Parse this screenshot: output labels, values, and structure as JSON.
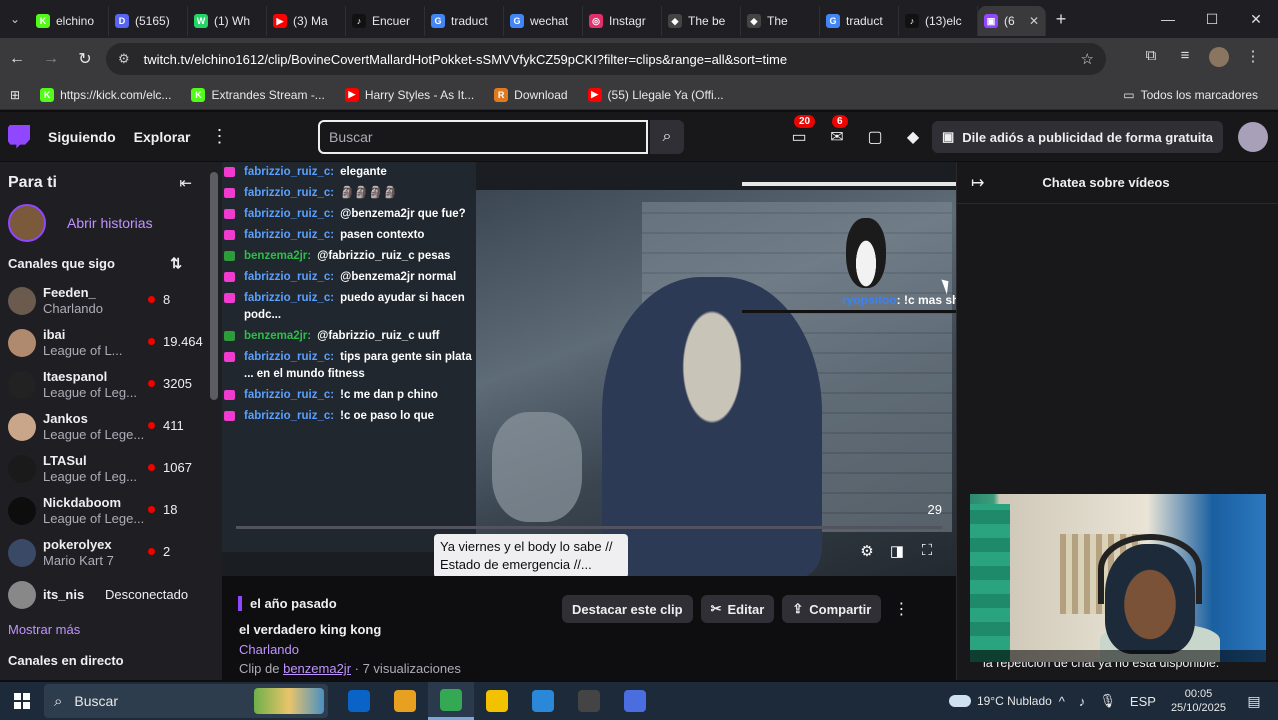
{
  "browser": {
    "tabs": [
      {
        "title": "elchino",
        "icon_color": "#53fc18",
        "icon_text": "K"
      },
      {
        "title": "(5165)",
        "icon_color": "#5865f2",
        "icon_text": "D"
      },
      {
        "title": "(1) Wh",
        "icon_color": "#25d366",
        "icon_text": "W"
      },
      {
        "title": "(3) Ma",
        "icon_color": "#ff0000",
        "icon_text": "▶"
      },
      {
        "title": "Encuer",
        "icon_color": "#111111",
        "icon_text": "♪"
      },
      {
        "title": "traduct",
        "icon_color": "#4285f4",
        "icon_text": "G"
      },
      {
        "title": "wechat",
        "icon_color": "#4285f4",
        "icon_text": "G"
      },
      {
        "title": "Instagr",
        "icon_color": "#e1306c",
        "icon_text": "◎"
      },
      {
        "title": "The be",
        "icon_color": "#444444",
        "icon_text": "◆"
      },
      {
        "title": "The",
        "icon_color": "#444444",
        "icon_text": "◆"
      },
      {
        "title": "traduct",
        "icon_color": "#4285f4",
        "icon_text": "G"
      },
      {
        "title": "(13)elc",
        "icon_color": "#111111",
        "icon_text": "♪"
      }
    ],
    "active_tab": {
      "title": "(6",
      "icon_color": "#9147ff",
      "icon_text": "▣"
    },
    "url": "twitch.tv/elchino1612/clip/BovineCovertMallardHotPokket-sSMVVfykCZ59pCKI?filter=clips&range=all&sort=time",
    "bookmarks": [
      {
        "label": "https://kick.com/elc...",
        "icon_color": "#53fc18",
        "icon_text": "K"
      },
      {
        "label": "Extrandes Stream -...",
        "icon_color": "#53fc18",
        "icon_text": "K"
      },
      {
        "label": "Harry Styles - As It...",
        "icon_color": "#ff0000",
        "icon_text": "▶"
      },
      {
        "label": "Download",
        "icon_color": "#e07a1f",
        "icon_text": "R"
      },
      {
        "label": "(55) Llegale Ya (Offi...",
        "icon_color": "#ff0000",
        "icon_text": "▶"
      }
    ],
    "all_bookmarks": "Todos los marcadores"
  },
  "twitch_nav": {
    "following": "Siguiendo",
    "browse": "Explorar",
    "search_placeholder": "Buscar",
    "notifications_count": "20",
    "inbox_count": "6",
    "ads_label": "Dile adiós a publicidad de forma gratuita"
  },
  "sidebar": {
    "for_you": "Para ti",
    "open_stories": "Abrir historias",
    "followed_header": "Canales que sigo",
    "channels": [
      {
        "name": "Feeden_",
        "game": "Charlando",
        "viewers": "8",
        "avatar_color": "#6b5a4e"
      },
      {
        "name": "ibai",
        "game": "League of L...",
        "viewers": "19.464",
        "avatar_color": "#b08a6e"
      },
      {
        "name": "Itaespanol",
        "game": "League of Leg...",
        "viewers": "3205",
        "avatar_color": "#222222"
      },
      {
        "name": "Jankos",
        "game": "League of Lege...",
        "viewers": "411",
        "avatar_color": "#c9a58a"
      },
      {
        "name": "LTASul",
        "game": "League of Leg...",
        "viewers": "1067",
        "avatar_color": "#1a1a1a"
      },
      {
        "name": "Nickdaboom",
        "game": "League of Lege...",
        "viewers": "18",
        "avatar_color": "#0d0d0d"
      },
      {
        "name": "pokerolyex",
        "game": "Mario Kart 7",
        "viewers": "2",
        "avatar_color": "#3a4a66"
      }
    ],
    "offline_channel": {
      "name": "its_nis",
      "status": "Desconectado",
      "avatar_color": "#888888"
    },
    "show_more": "Mostrar más",
    "live_header": "Canales en directo"
  },
  "video": {
    "chat_overlay": [
      {
        "user": "fabrizzio_ruiz_c:",
        "text": "elegante",
        "icon": "pink"
      },
      {
        "user": "fabrizzio_ruiz_c:",
        "text": "🗿🗿🗿🗿",
        "icon": "pink"
      },
      {
        "user": "fabrizzio_ruiz_c:",
        "text": "@benzema2jr que fue?",
        "icon": "pink"
      },
      {
        "user": "fabrizzio_ruiz_c:",
        "text": "pasen contexto",
        "icon": "pink"
      },
      {
        "user": "benzema2jr:",
        "text": "@fabrizzio_ruiz_c pesas",
        "icon": "green"
      },
      {
        "user": "fabrizzio_ruiz_c:",
        "text": "@benzema2jr normal",
        "icon": "pink"
      },
      {
        "user": "fabrizzio_ruiz_c:",
        "text": "puedo ayudar si hacen podc...",
        "icon": "pink"
      },
      {
        "user": "benzema2jr:",
        "text": "@fabrizzio_ruiz_c uuff",
        "icon": "green"
      },
      {
        "user": "fabrizzio_ruiz_c:",
        "text": "tips para gente sin plata ... en el mundo fitness",
        "icon": "pink"
      },
      {
        "user": "fabrizzio_ruiz_c:",
        "text": "!c me dan p chino",
        "icon": "pink"
      },
      {
        "user": "fabrizzio_ruiz_c:",
        "text": "!c oe paso lo que",
        "icon": "pink"
      }
    ],
    "overlay_chat": {
      "user": "ryopsitoo",
      "text": ": !c mas show chino :v"
    },
    "tooltip": "Ya viernes y el body lo sabe // Estado de emergencia //...",
    "time_counter": "29"
  },
  "clip": {
    "when": "el año pasado",
    "title": "el verdadero king kong",
    "game": "Charlando",
    "clipped_by_prefix": "Clip de",
    "clipper": "benzema2jr",
    "views": " · 7 visualizaciones",
    "feature_btn": "Destacar este clip",
    "edit_btn": "Editar",
    "share_btn": "Compartir"
  },
  "right_chat": {
    "title": "Chatea sobre vídeos",
    "unavailable": "la repetición de chat ya no está disponible."
  },
  "taskbar": {
    "search": "Buscar",
    "weather": "19°C  Nublado",
    "lang": "ESP",
    "time": "00:05",
    "date": "25/10/2025",
    "apps": [
      {
        "name": "outlook",
        "color": "#0a64c8"
      },
      {
        "name": "games",
        "color": "#e8a020"
      },
      {
        "name": "chrome",
        "color": "#34a853"
      },
      {
        "name": "explorer",
        "color": "#f2c200"
      },
      {
        "name": "store",
        "color": "#2b88d8"
      },
      {
        "name": "obs",
        "color": "#444444"
      },
      {
        "name": "vpn",
        "color": "#4a6ee0"
      }
    ],
    "active_app": "chrome"
  }
}
